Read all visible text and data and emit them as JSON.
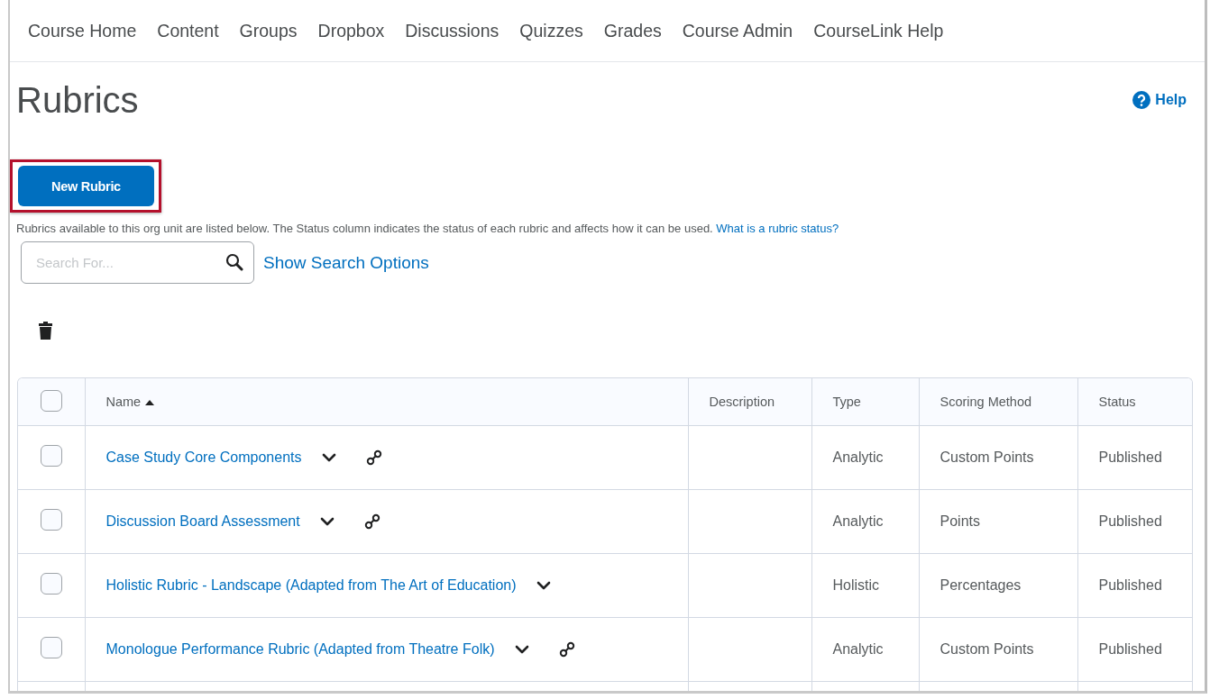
{
  "nav": {
    "items": [
      {
        "label": "Course Home"
      },
      {
        "label": "Content"
      },
      {
        "label": "Groups"
      },
      {
        "label": "Dropbox"
      },
      {
        "label": "Discussions"
      },
      {
        "label": "Quizzes"
      },
      {
        "label": "Grades"
      },
      {
        "label": "Course Admin"
      },
      {
        "label": "CourseLink Help"
      }
    ]
  },
  "page": {
    "title": "Rubrics",
    "help": "Help"
  },
  "new_button": {
    "label": "New Rubric",
    "highlighted": true
  },
  "intro": {
    "text": "Rubrics available to this org unit are listed below. The Status column indicates the status of each rubric and affects how it can be used.",
    "link": "What is a rubric status?"
  },
  "search": {
    "placeholder": "Search For...",
    "options_link": "Show Search Options"
  },
  "table": {
    "select_all": {
      "checked": false
    },
    "columns": [
      {
        "label": "Name",
        "sorted": true
      },
      {
        "label": "Description",
        "sorted": false
      },
      {
        "label": "Type",
        "sorted": false
      },
      {
        "label": "Scoring Method",
        "sorted": false
      },
      {
        "label": "Status",
        "sorted": false
      }
    ],
    "rows": [
      {
        "checked": false,
        "name": "Case Study Core Components",
        "linked": true,
        "type": "Analytic",
        "scoring": "Custom Points",
        "status": "Published"
      },
      {
        "checked": false,
        "name": "Discussion Board Assessment",
        "linked": true,
        "type": "Analytic",
        "scoring": "Points",
        "status": "Published"
      },
      {
        "checked": false,
        "name": "Holistic Rubric - Landscape (Adapted from The Art of Education)",
        "linked": false,
        "type": "Holistic",
        "scoring": "Percentages",
        "status": "Published"
      },
      {
        "checked": false,
        "name": "Monologue Performance Rubric (Adapted from Theatre Folk)",
        "linked": true,
        "type": "Analytic",
        "scoring": "Custom Points",
        "status": "Published"
      }
    ]
  }
}
